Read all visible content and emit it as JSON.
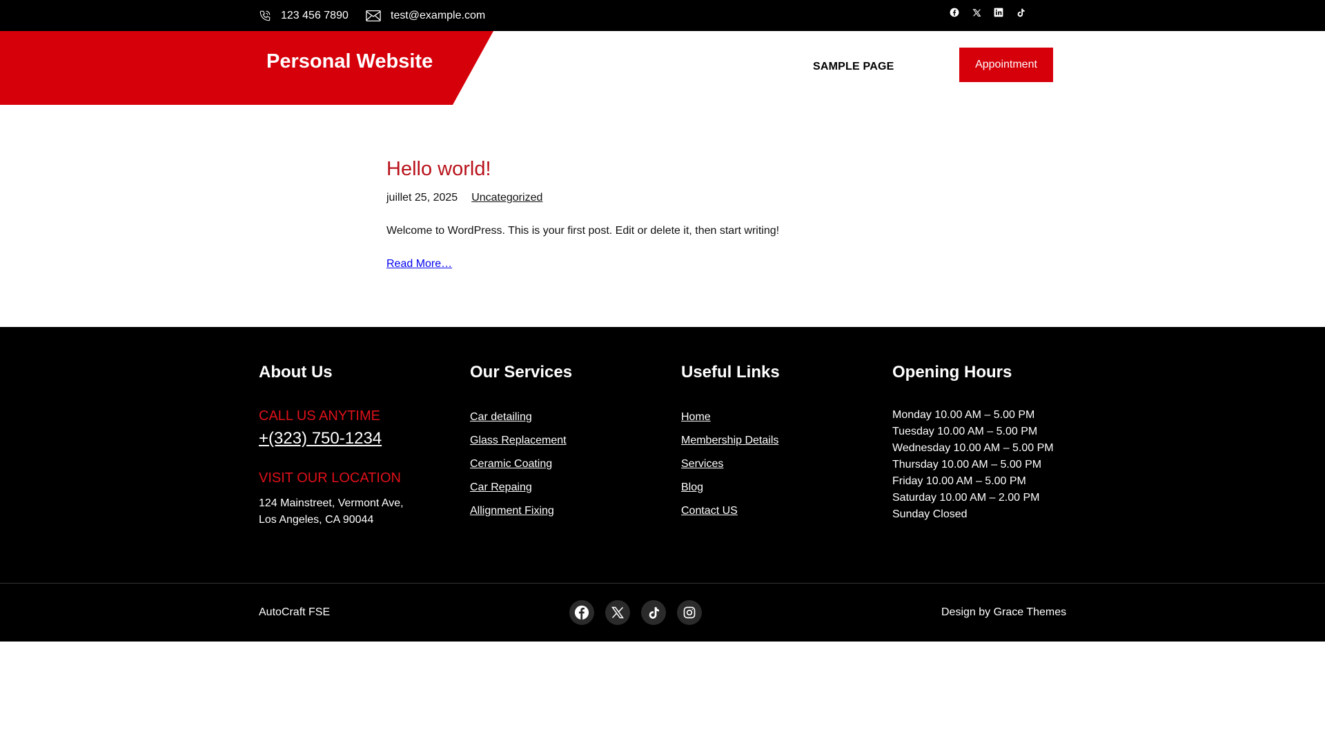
{
  "topbar": {
    "phone": "123 456 7890",
    "email": "test@example.com",
    "social_icons": [
      "facebook-icon",
      "x-icon",
      "linkedin-icon",
      "tiktok-icon"
    ]
  },
  "header": {
    "site_title": "Personal Website",
    "nav": [
      "SAMPLE PAGE"
    ],
    "appointment_label": "Appointment"
  },
  "post": {
    "title": "Hello world!",
    "date": "juillet 25, 2025",
    "category": "Uncategorized",
    "excerpt": "Welcome to WordPress. This is your first post. Edit or delete it, then start writing!",
    "read_more": "Read More…"
  },
  "footer": {
    "about": {
      "heading": "About Us",
      "call_label": "CALL US ANYTIME",
      "phone": "+(323) 750-1234",
      "visit_label": "VISIT OUR LOCATION",
      "address_line1": "124 Mainstreet, Vermont Ave,",
      "address_line2": "Los Angeles, CA 90044"
    },
    "services": {
      "heading": "Our Services",
      "items": [
        "Car detailing",
        "Glass Replacement",
        "Ceramic Coating",
        "Car Repaing",
        "Allignment Fixing"
      ]
    },
    "links": {
      "heading": "Useful Links",
      "items": [
        "Home",
        "Membership Details",
        "Services",
        "Blog",
        "Contact US"
      ]
    },
    "hours": {
      "heading": "Opening Hours",
      "items": [
        "Monday 10.00 AM – 5.00 PM",
        "Tuesday 10.00 AM – 5.00 PM",
        "Wednesday 10.00 AM – 5.00 PM",
        "Thursday 10.00 AM – 5.00 PM",
        "Friday 10.00 AM – 5.00 PM",
        "Saturday 10.00 AM – 2.00 PM",
        "Sunday Closed"
      ]
    },
    "bottom": {
      "site_name": "AutoCraft FSE",
      "credit": "Design by Grace Themes",
      "social_icons": [
        "facebook-icon",
        "x-icon",
        "tiktok-icon",
        "instagram-icon"
      ]
    }
  },
  "colors": {
    "accent": "#d6000a",
    "post_title": "#b8121a",
    "label_red": "#e0111a",
    "footer_bg": "#000000",
    "topbar_bg": "#000000"
  }
}
